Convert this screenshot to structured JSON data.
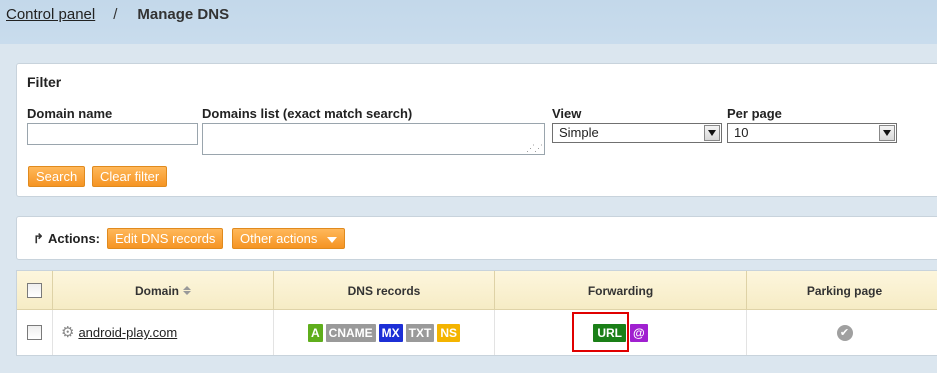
{
  "breadcrumb": {
    "root": "Control panel",
    "separator": "/",
    "current": "Manage DNS"
  },
  "filter": {
    "title": "Filter",
    "domain_name_label": "Domain name",
    "domain_name_value": "",
    "domains_list_label": "Domains list (exact match search)",
    "domains_list_value": "",
    "view_label": "View",
    "view_selected": "Simple",
    "per_page_label": "Per page",
    "per_page_selected": "10",
    "search_label": "Search",
    "clear_label": "Clear filter"
  },
  "actions": {
    "label": "Actions:",
    "edit_dns_label": "Edit DNS records",
    "other_actions_label": "Other actions"
  },
  "table": {
    "columns": [
      "Domain",
      "DNS records",
      "Forwarding",
      "Parking page"
    ],
    "rows": [
      {
        "domain": "android-play.com",
        "dns_records": [
          {
            "label": "A",
            "color": "#5fae1c"
          },
          {
            "label": "CNAME",
            "color": "#9a9a9a"
          },
          {
            "label": "MX",
            "color": "#1c2fd6"
          },
          {
            "label": "TXT",
            "color": "#9a9a9a"
          },
          {
            "label": "NS",
            "color": "#f4b400"
          }
        ],
        "forwarding": [
          {
            "label": "URL",
            "color": "#1a7f17"
          },
          {
            "label": "@",
            "color": "#a020d0"
          }
        ],
        "parking_icon": "check-circle-icon"
      }
    ]
  },
  "colors": {
    "accent_orange": "#f59423",
    "highlight_red": "#e00000"
  }
}
